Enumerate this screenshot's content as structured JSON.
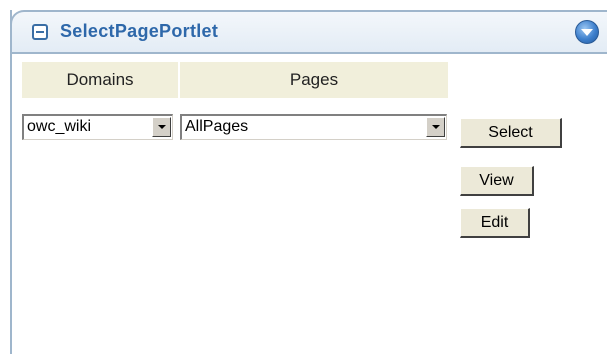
{
  "portlet": {
    "title": "SelectPagePortlet"
  },
  "headers": {
    "domains": "Domains",
    "pages": "Pages"
  },
  "selects": {
    "domain": {
      "value": "owc_wiki"
    },
    "page": {
      "value": "AllPages"
    }
  },
  "buttons": {
    "select": "Select",
    "view": "View",
    "edit": "Edit"
  },
  "icons": {
    "collapse": "minus-square-icon",
    "menu": "chevron-down-circle-icon"
  },
  "colors": {
    "title": "#2e68aa",
    "header_bg": "#f1efdb",
    "border": "#9fb6cc"
  }
}
